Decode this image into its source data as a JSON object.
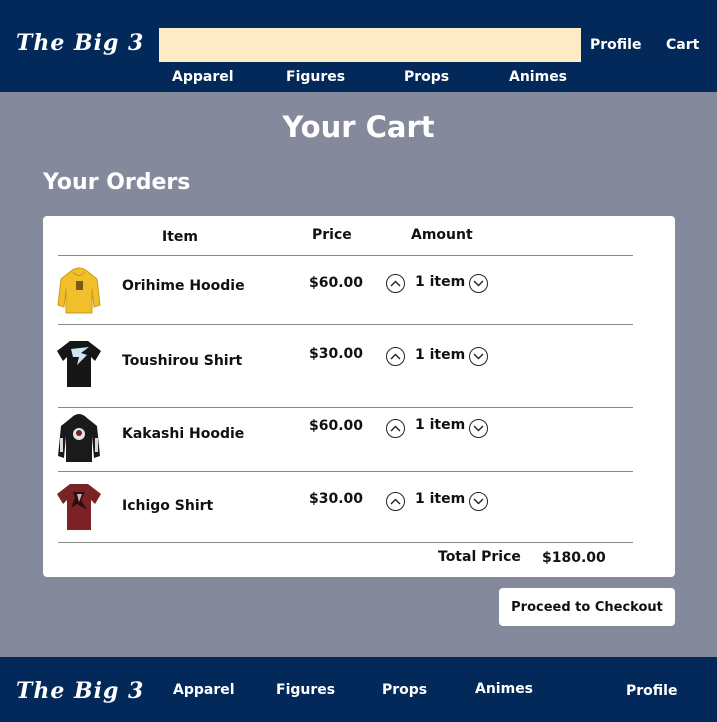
{
  "header": {
    "logo": "The Big 3",
    "search": {
      "value": "",
      "placeholder": ""
    },
    "links": {
      "profile": "Profile",
      "cart": "Cart"
    },
    "nav": [
      "Apparel",
      "Figures",
      "Props",
      "Animes"
    ]
  },
  "page_title": "Your Cart",
  "orders": {
    "title": "Your Orders",
    "columns": {
      "item": "Item",
      "price": "Price",
      "amount": "Amount"
    },
    "rows": [
      {
        "name": "Orihime Hoodie",
        "price": "$60.00",
        "amount": "1 item",
        "thumb_icon": "yellow-hoodie-icon",
        "thumb_color": "#f2bf2c"
      },
      {
        "name": "Toushirou Shirt",
        "price": "$30.00",
        "amount": "1 item",
        "thumb_icon": "black-shirt-icon",
        "thumb_color": "#161616"
      },
      {
        "name": "Kakashi Hoodie",
        "price": "$60.00",
        "amount": "1 item",
        "thumb_icon": "black-hoodie-icon",
        "thumb_color": "#1a1a1a"
      },
      {
        "name": "Ichigo Shirt",
        "price": "$30.00",
        "amount": "1 item",
        "thumb_icon": "maroon-shirt-icon",
        "thumb_color": "#7a2224"
      }
    ],
    "total_label": "Total Price",
    "total_value": "$180.00"
  },
  "checkout_label": "Proceed to Checkout",
  "footer": {
    "logo": "The Big 3",
    "nav": [
      "Apparel",
      "Figures",
      "Props",
      "Animes"
    ],
    "profile": "Profile"
  },
  "colors": {
    "navy": "#03295a",
    "page_background": "#848a9b",
    "search_background": "#fdebc6",
    "card": "#ffffff"
  }
}
